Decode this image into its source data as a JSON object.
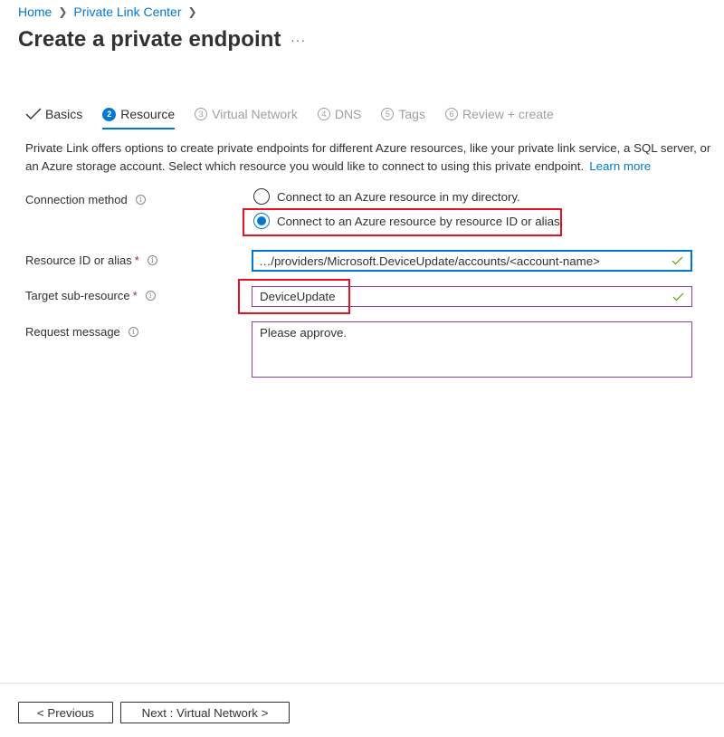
{
  "breadcrumb": {
    "items": [
      "Home",
      "Private Link Center"
    ],
    "separator": ">"
  },
  "page": {
    "title": "Create a private endpoint",
    "more_label": "···"
  },
  "tabs": [
    {
      "label": "Basics",
      "number": "",
      "state": "done"
    },
    {
      "label": "Resource",
      "number": "2",
      "state": "active"
    },
    {
      "label": "Virtual Network",
      "number": "3",
      "state": "disabled"
    },
    {
      "label": "DNS",
      "number": "4",
      "state": "disabled"
    },
    {
      "label": "Tags",
      "number": "5",
      "state": "disabled"
    },
    {
      "label": "Review + create",
      "number": "6",
      "state": "disabled"
    }
  ],
  "description": {
    "text": "Private Link offers options to create private endpoints for different Azure resources, like your private link service, a SQL server, or an Azure storage account. Select which resource you would like to connect to using this private endpoint.",
    "link": "Learn more"
  },
  "form": {
    "connection_method": {
      "label": "Connection method",
      "info": "i",
      "options": [
        {
          "label": "Connect to an Azure resource in my directory.",
          "selected": false
        },
        {
          "label": "Connect to an Azure resource by resource ID or alias.",
          "selected": true
        }
      ]
    },
    "resource_id": {
      "label": "Resource ID or alias",
      "required": "*",
      "info": "i",
      "value": "…/providers/Microsoft.DeviceUpdate/accounts/<account-name>"
    },
    "target_sub_resource": {
      "label": "Target sub-resource",
      "required": "*",
      "info": "i",
      "value": "DeviceUpdate"
    },
    "request_message": {
      "label": "Request message",
      "info": "i",
      "value": "Please approve."
    }
  },
  "footer": {
    "previous_label": "< Previous",
    "next_label": "Next : Virtual Network >"
  },
  "colors": {
    "accent": "#0078d4",
    "highlight": "#e81123",
    "valid_border": "#8a3ea8",
    "valid_check": "#57a300",
    "required": "#a4262c"
  }
}
